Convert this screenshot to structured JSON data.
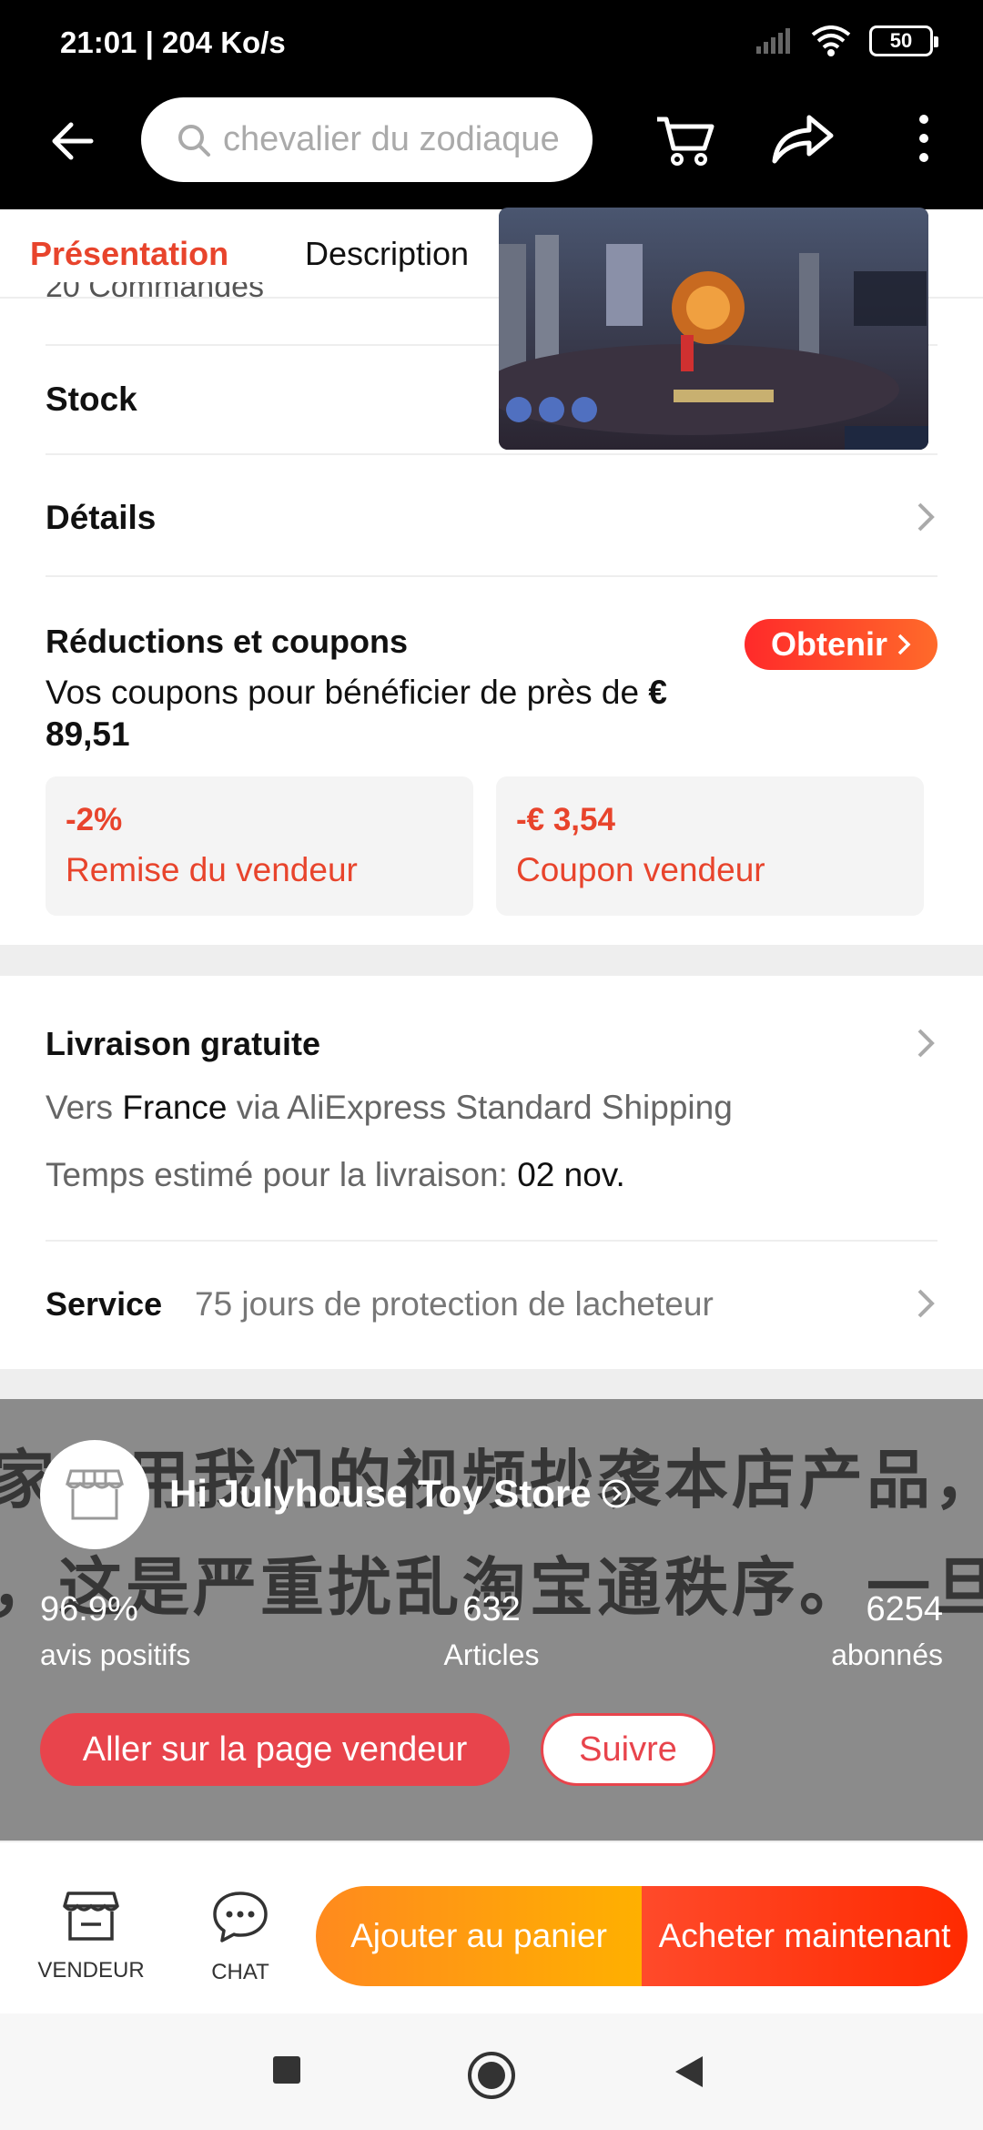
{
  "status_bar": {
    "time": "21:01 | 204 Ko/s",
    "battery": "50"
  },
  "header": {
    "search_placeholder": "chevalier du zodiaque",
    "icons": [
      "back-arrow-icon",
      "search-icon",
      "cart-icon",
      "share-icon",
      "more-vertical-icon"
    ]
  },
  "tabs": [
    {
      "label": "Présentation",
      "active": true
    },
    {
      "label": "Description",
      "active": false
    }
  ],
  "peek_text": "20 Commandes",
  "rows": {
    "stock": "Stock",
    "details": "Détails"
  },
  "coupons": {
    "title": "Réductions et coupons",
    "subtitle_prefix": "Vos coupons pour bénéficier de près de ",
    "subtitle_amount": "€ 89,51",
    "obtain_label": "Obtenir",
    "items": [
      {
        "value": "-2%",
        "label": "Remise du vendeur"
      },
      {
        "value": "-€ 3,54",
        "label": "Coupon vendeur"
      }
    ]
  },
  "shipping": {
    "title": "Livraison gratuite",
    "line1_prefix": "Vers ",
    "line1_country": "France",
    "line1_suffix": " via AliExpress Standard Shipping",
    "line2_prefix": "Temps estimé pour la livraison: ",
    "line2_date": "02 nov."
  },
  "service": {
    "title": "Service",
    "text": "75 jours de protection de lacheteur"
  },
  "store": {
    "name": "Hi Julyhouse Toy Store",
    "overlay_line1": "家使用我们的视频抄袭本店产品，特别严重，我已举报相关店铺，这里我就不直接说是哪家，相关",
    "overlay_line2": "，这是严重扰乱淘宝通秩序。一旦查实成立，封店处理，请警示！",
    "stats": [
      {
        "value": "96.9%",
        "label": "avis positifs"
      },
      {
        "value": "632",
        "label": "Articles"
      },
      {
        "value": "6254",
        "label": "abonnés"
      }
    ],
    "visit_label": "Aller sur la page vendeur",
    "follow_label": "Suivre"
  },
  "bottom_bar": {
    "seller_label": "VENDEUR",
    "chat_label": "CHAT",
    "cart_label": "Ajouter au panier",
    "buy_label": "Acheter maintenant"
  },
  "colors": {
    "accent": "#e8442c",
    "cart": "#ff9a10",
    "buy": "#ff3a10"
  }
}
